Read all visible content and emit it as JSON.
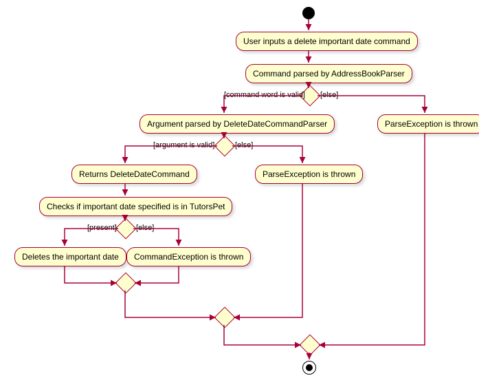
{
  "nodes": {
    "n1": "User inputs a delete important date command",
    "n2": "Command parsed by AddressBookParser",
    "n3": "Argument parsed by DeleteDateCommandParser",
    "n4": "ParseException is thrown",
    "n5": "Returns DeleteDateCommand",
    "n6": "ParseException is thrown",
    "n7": "Checks if important date specified is in TutorsPet",
    "n8": "Deletes the important date",
    "n9": "CommandException is thrown"
  },
  "labels": {
    "d1_left": "[command word is valid]",
    "d1_right": "[else]",
    "d2_left": "[argument is valid]",
    "d2_right": "[else]",
    "d3_left": "[present]",
    "d3_right": "[else]"
  }
}
